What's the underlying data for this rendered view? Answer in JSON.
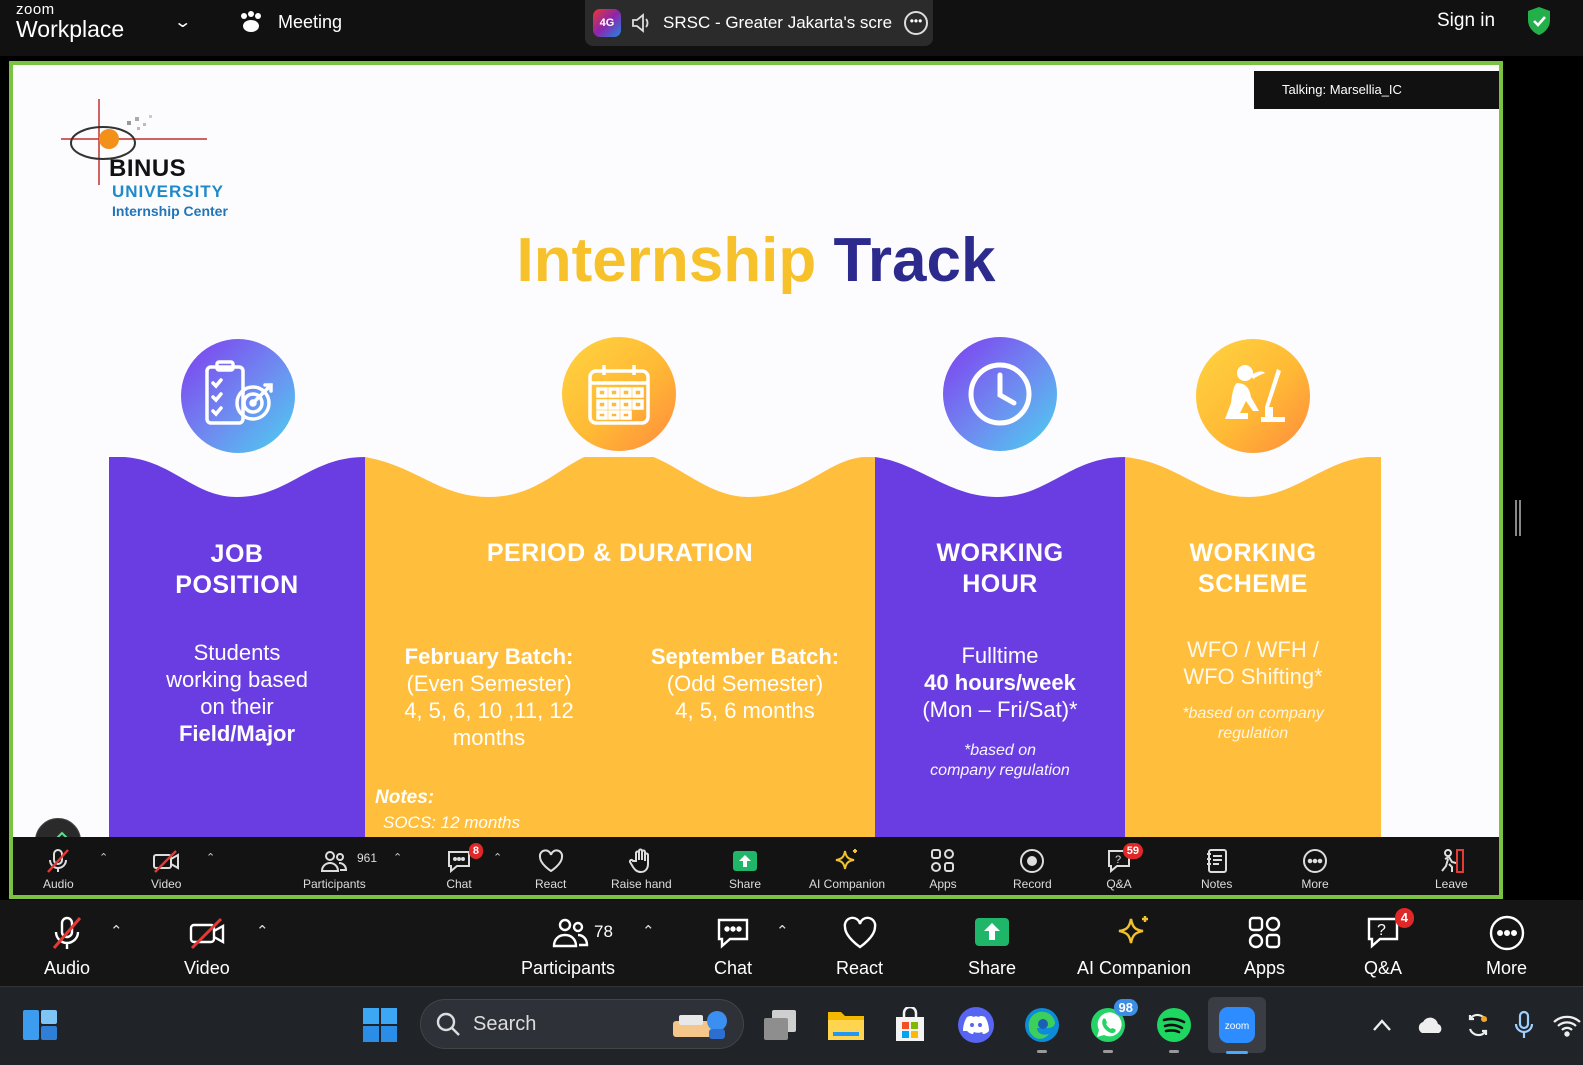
{
  "topbar": {
    "brand_small": "zoom",
    "brand_big": "Workplace",
    "meeting_label": "Meeting",
    "share_title": "SRSC - Greater Jakarta's scre",
    "share_app_badge": "4G",
    "sign_in": "Sign in"
  },
  "slide": {
    "talking": "Talking: Marsellia_IC",
    "logo": {
      "line1": "BINUS",
      "line2": "UNIVERSITY",
      "line3": "Internship Center"
    },
    "title_part1": "Internship",
    "title_part2": "Track",
    "col1": {
      "head1": "JOB",
      "head2": "POSITION",
      "line1": "Students",
      "line2": "working based",
      "line3": "on their",
      "line4": "Field/Major"
    },
    "col2": {
      "head": "PERIOD & DURATION",
      "feb_title": "February Batch:",
      "feb_l1": "(Even Semester)",
      "feb_l2": "4, 5, 6, 10 ,11, 12",
      "feb_l3": "months",
      "sep_title": "September Batch:",
      "sep_l1": "(Odd Semester)",
      "sep_l2": "4, 5, 6 months",
      "notes_title": "Notes:",
      "notes_l1": "SOCS: 12 months"
    },
    "col3": {
      "head1": "WORKING",
      "head2": "HOUR",
      "line1": "Fulltime",
      "line2": "40 hours/week",
      "line3": "(Mon – Fri/Sat)*",
      "note1": "*based on",
      "note2": "company regulation"
    },
    "col4": {
      "head1": "WORKING",
      "head2": "SCHEME",
      "line1": "WFO / WFH /",
      "line2": "WFO Shifting*",
      "note1": "*based on company",
      "note2": "regulation"
    }
  },
  "inner_toolbar": {
    "audio": "Audio",
    "video": "Video",
    "participants": "Participants",
    "participants_count": "961",
    "chat": "Chat",
    "chat_badge": "8",
    "react": "React",
    "raise_hand": "Raise hand",
    "share": "Share",
    "ai_companion": "AI Companion",
    "apps": "Apps",
    "record": "Record",
    "qa": "Q&A",
    "qa_badge": "59",
    "notes": "Notes",
    "more": "More",
    "leave": "Leave"
  },
  "main_toolbar": {
    "audio": "Audio",
    "video": "Video",
    "participants": "Participants",
    "participants_count": "78",
    "chat": "Chat",
    "react": "React",
    "share": "Share",
    "ai_companion": "AI Companion",
    "apps": "Apps",
    "qa": "Q&A",
    "qa_badge": "4",
    "more": "More"
  },
  "taskbar": {
    "search_label": "Search",
    "whatsapp_badge": "98"
  },
  "colors": {
    "accent_green": "#7bc142",
    "purple": "#6a3de3",
    "yellow": "#ffbe3b",
    "title_navy": "#2d2a8e"
  }
}
